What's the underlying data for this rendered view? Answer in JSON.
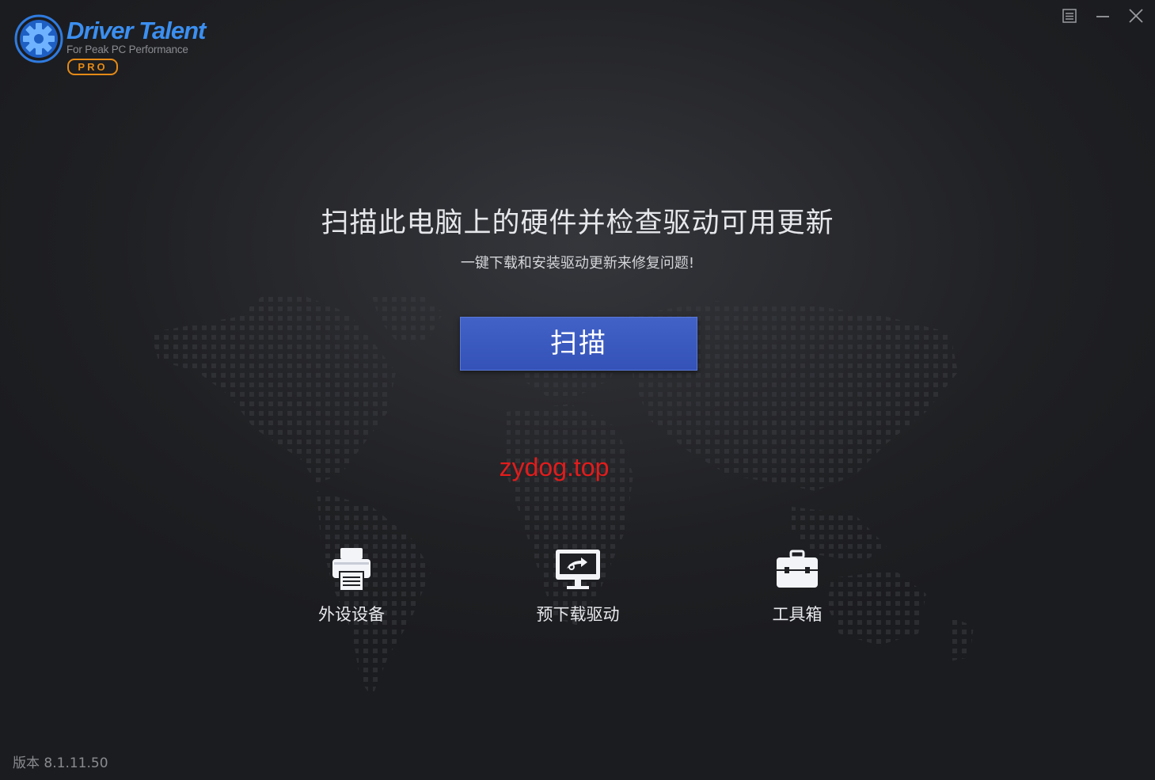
{
  "app": {
    "name": "Driver Talent",
    "tagline": "For Peak PC Performance",
    "edition": "PRO",
    "accent_color": "#3b8ff0",
    "edition_color": "#e58a16"
  },
  "window_controls": [
    {
      "name": "menu-icon"
    },
    {
      "name": "minimize-icon"
    },
    {
      "name": "close-icon"
    }
  ],
  "main": {
    "headline": "扫描此电脑上的硬件并检查驱动可用更新",
    "subline": "一键下载和安装驱动更新来修复问题!",
    "scan_button": "扫描",
    "scan_button_color": "#3a58c0"
  },
  "watermark": "zydog.top",
  "features": [
    {
      "label": "外设设备",
      "icon": "printer-icon"
    },
    {
      "label": "预下载驱动",
      "icon": "monitor-download-icon"
    },
    {
      "label": "工具箱",
      "icon": "toolbox-icon"
    }
  ],
  "footer": {
    "version": "版本 8.1.11.50"
  }
}
